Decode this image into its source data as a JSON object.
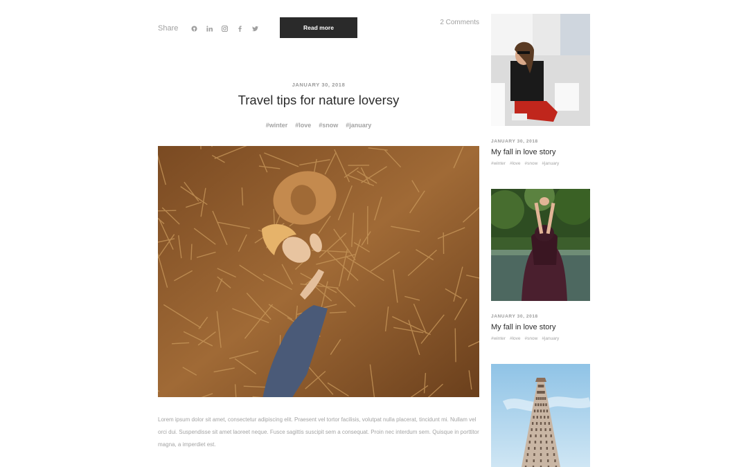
{
  "share": {
    "label": "Share",
    "icons": [
      "pinterest-icon",
      "linkedin-icon",
      "instagram-icon",
      "facebook-icon",
      "twitter-icon"
    ]
  },
  "read_more_label": "Read more",
  "comments_label": "2 Comments",
  "post": {
    "date": "JANUARY 30, 2018",
    "title": "Travel tips for nature loversy",
    "tags": [
      "#winter",
      "#love",
      "#snow",
      "#january"
    ],
    "body": "Lorem ipsum dolor sit amet, consectetur adipiscing elit. Praesent vel tortor facilisis, volutpat nulla placerat, tincidunt mi. Nullam vel orci dui. Suspendisse sit amet laoreet neque. Fusce sagittis suscipit sem a consequat. Proin nec interdum sem. Quisque in porttitor magna, a imperdiet est."
  },
  "sidebar": {
    "posts": [
      {
        "date": "JANUARY 30, 2018",
        "title": "My fall in love story",
        "tags": [
          "#winter",
          "#love",
          "#snow",
          "#january"
        ]
      },
      {
        "date": "JANUARY 30, 2018",
        "title": "My fall in love story",
        "tags": [
          "#winter",
          "#love",
          "#snow",
          "#january"
        ]
      }
    ]
  },
  "colors": {
    "button_bg": "#2a2a2a",
    "muted_text": "#a3a3a3",
    "heading_text": "#2b2b2b"
  }
}
